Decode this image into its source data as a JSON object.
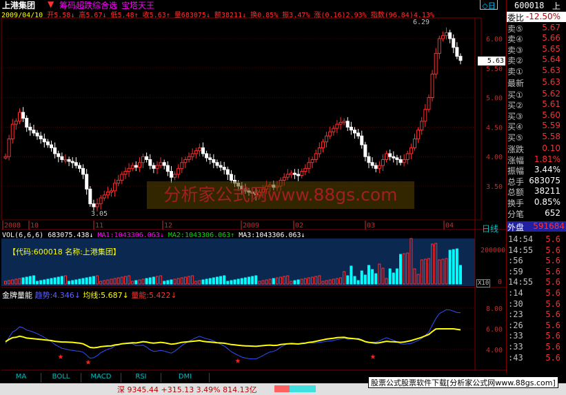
{
  "header": {
    "stock_name": "上港集团",
    "links": [
      "筹码超跌综合选",
      "宝塔天王"
    ],
    "date": "2009/04/10",
    "open": "开5.58↓",
    "high": "高5.67↓",
    "low": "低5.48↑",
    "close": "收5.63↑",
    "vol": "量683075↓",
    "amount": "额38211↓",
    "turnover": "换0.85%",
    "amp": "振3.47%",
    "change": "涨(0.16)2.93%",
    "index": "指数(96.84)4.13%"
  },
  "kchart": {
    "max_label": "6.29",
    "min_label": "3.05",
    "cur_price": "5.63",
    "y_ticks": [
      "6.00",
      "5.50",
      "5.00",
      "4.50",
      "4.00",
      "3.50"
    ],
    "x_labels": [
      "2008",
      "10",
      "11",
      "12",
      "2009",
      "02",
      "03",
      "04"
    ],
    "watermark": "分析家公式网www.88gs.com"
  },
  "vol": {
    "params": "VOL(6,6,6)",
    "v": "683075.438↓",
    "ma1": "MA1:1043306.063↓",
    "ma2": "MA2:1043306.063↑",
    "ma3": "MA3:1043306.063↓",
    "code_label": "【代码:600018 名称:上港集团】",
    "y_ticks": [
      "200000",
      "0"
    ],
    "unit": "X10"
  },
  "ind": {
    "name": "金牌量能",
    "trend": "趋势:4.346↓",
    "avg": "均线:5.687↓",
    "energy": "量能:5.422↓",
    "y_ticks": [
      "8.00",
      "6.00",
      "4.00"
    ]
  },
  "tabs": [
    "MA",
    "BOLL",
    "MACD",
    "RSI",
    "DMI"
  ],
  "status": {
    "index": "深 9345.44 +315.13 3.49% 814.13亿",
    "promo": "股票公式股票软件下载[分析家公式网www.88gs.com]"
  },
  "quote": {
    "code": "600018",
    "market": "上",
    "ratio_label": "委比",
    "ratio": "-12.50%",
    "sells": [
      {
        "l": "卖⑤",
        "v": "5.67"
      },
      {
        "l": "卖④",
        "v": "5.66"
      },
      {
        "l": "卖③",
        "v": "5.65"
      },
      {
        "l": "卖②",
        "v": "5.64"
      },
      {
        "l": "卖①",
        "v": "5.63"
      }
    ],
    "last_label": "最新",
    "last": "5.63",
    "buys": [
      {
        "l": "买①",
        "v": "5.62"
      },
      {
        "l": "买②",
        "v": "5.61"
      },
      {
        "l": "买③",
        "v": "5.60"
      },
      {
        "l": "买④",
        "v": "5.59"
      },
      {
        "l": "买⑤",
        "v": "5.58"
      }
    ],
    "stats": [
      {
        "l": "涨跌",
        "v": "0.10"
      },
      {
        "l": "涨幅",
        "v": "1.81%"
      },
      {
        "l": "振幅",
        "v": "3.44%"
      },
      {
        "l": "总手",
        "v": "683075"
      },
      {
        "l": "总额",
        "v": "38211"
      },
      {
        "l": "换手",
        "v": "0.85%"
      },
      {
        "l": "分笔",
        "v": "652"
      }
    ],
    "period": "日线",
    "outer_label": "外盘",
    "outer": "591684",
    "ticks": [
      {
        "t": "14:54",
        "p": "5.6"
      },
      {
        "t": "14:55",
        "p": "5.6"
      },
      {
        "t": ":56",
        "p": "5.6"
      },
      {
        "t": ":59",
        "p": "5.6"
      },
      {
        "t": "14:55",
        "p": "5.6"
      },
      {
        "t": ":14",
        "p": "5.6"
      },
      {
        "t": ":30",
        "p": "5.6"
      },
      {
        "t": ":23",
        "p": "5.6"
      },
      {
        "t": ":26",
        "p": "5.6"
      },
      {
        "t": ":33",
        "p": "5.6"
      },
      {
        "t": ":33",
        "p": "5.6"
      },
      {
        "t": ":43",
        "p": "5.6"
      }
    ]
  },
  "colors": {
    "up": "#ff3030",
    "down": "#00ffff",
    "bg": "#000000",
    "grid": "#660000",
    "accent": "#ffff00"
  }
}
